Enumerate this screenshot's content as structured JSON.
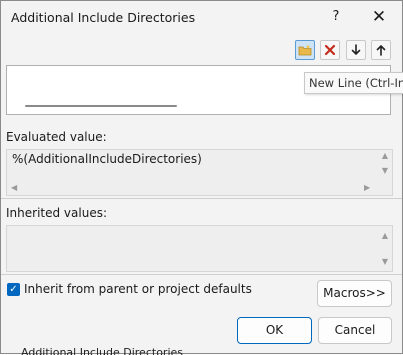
{
  "window": {
    "title": "Additional Include Directories",
    "help_label": "?",
    "close_label": "✕"
  },
  "toolbar": {
    "new_line_icon": "new-folder-icon",
    "delete_icon": "delete-x-icon",
    "move_down_icon": "arrow-down-icon",
    "move_up_icon": "arrow-up-icon"
  },
  "tooltip": {
    "text": "New Line (Ctrl-Ins"
  },
  "evaluated": {
    "label": "Evaluated value:",
    "value": "%(AdditionalIncludeDirectories)"
  },
  "inherited": {
    "label": "Inherited values:"
  },
  "inherit_checkbox": {
    "label": "Inherit from parent or project defaults",
    "checked": true
  },
  "buttons": {
    "macros": "Macros>>",
    "ok": "OK",
    "cancel": "Cancel"
  },
  "background_text": "Additional Include Directories",
  "colors": {
    "accent": "#0067c0",
    "delete": "#c42b1c"
  }
}
